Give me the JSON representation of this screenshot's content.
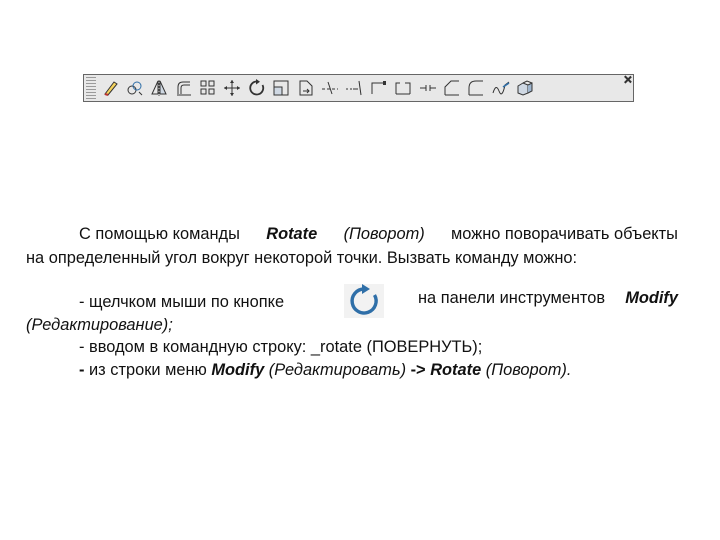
{
  "toolbar": {
    "icons": [
      "erase-icon",
      "copy-icon",
      "mirror-icon",
      "offset-icon",
      "array-icon",
      "move-icon",
      "rotate-icon",
      "scale-icon",
      "stretch-icon",
      "trim-icon",
      "extend-icon",
      "break-at-point-icon",
      "break-icon",
      "join-icon",
      "chamfer-icon",
      "fillet-icon",
      "blend-curves-icon",
      "explode-icon"
    ]
  },
  "paragraph": {
    "l1_a": "С помощью команды",
    "l1_cmd": "Rotate",
    "l1_ru": "(Поворот)",
    "l1_b": "можно поворачивать объекты",
    "l2": "на определенный угол вокруг некоторой точки. Вызвать команду можно:"
  },
  "items": {
    "i1_a": "- щелчком мыши по кнопке",
    "i1_b": "на панели инструментов",
    "i1_menu": "Modify",
    "i1_c": "(Редактирование);",
    "i2_a": "- вводом в командную строку: _rotate (ПОВЕРНУТЬ);",
    "i3_dash": "-",
    "i3_a": "из строки меню",
    "i3_menu": "Modify",
    "i3_ru": "(Редактировать)",
    "i3_arrow": "->",
    "i3_cmd": "Rotate",
    "i3_ru2": "(Поворот)."
  },
  "colors": {
    "rotate_icon": "#2f6fa8"
  }
}
